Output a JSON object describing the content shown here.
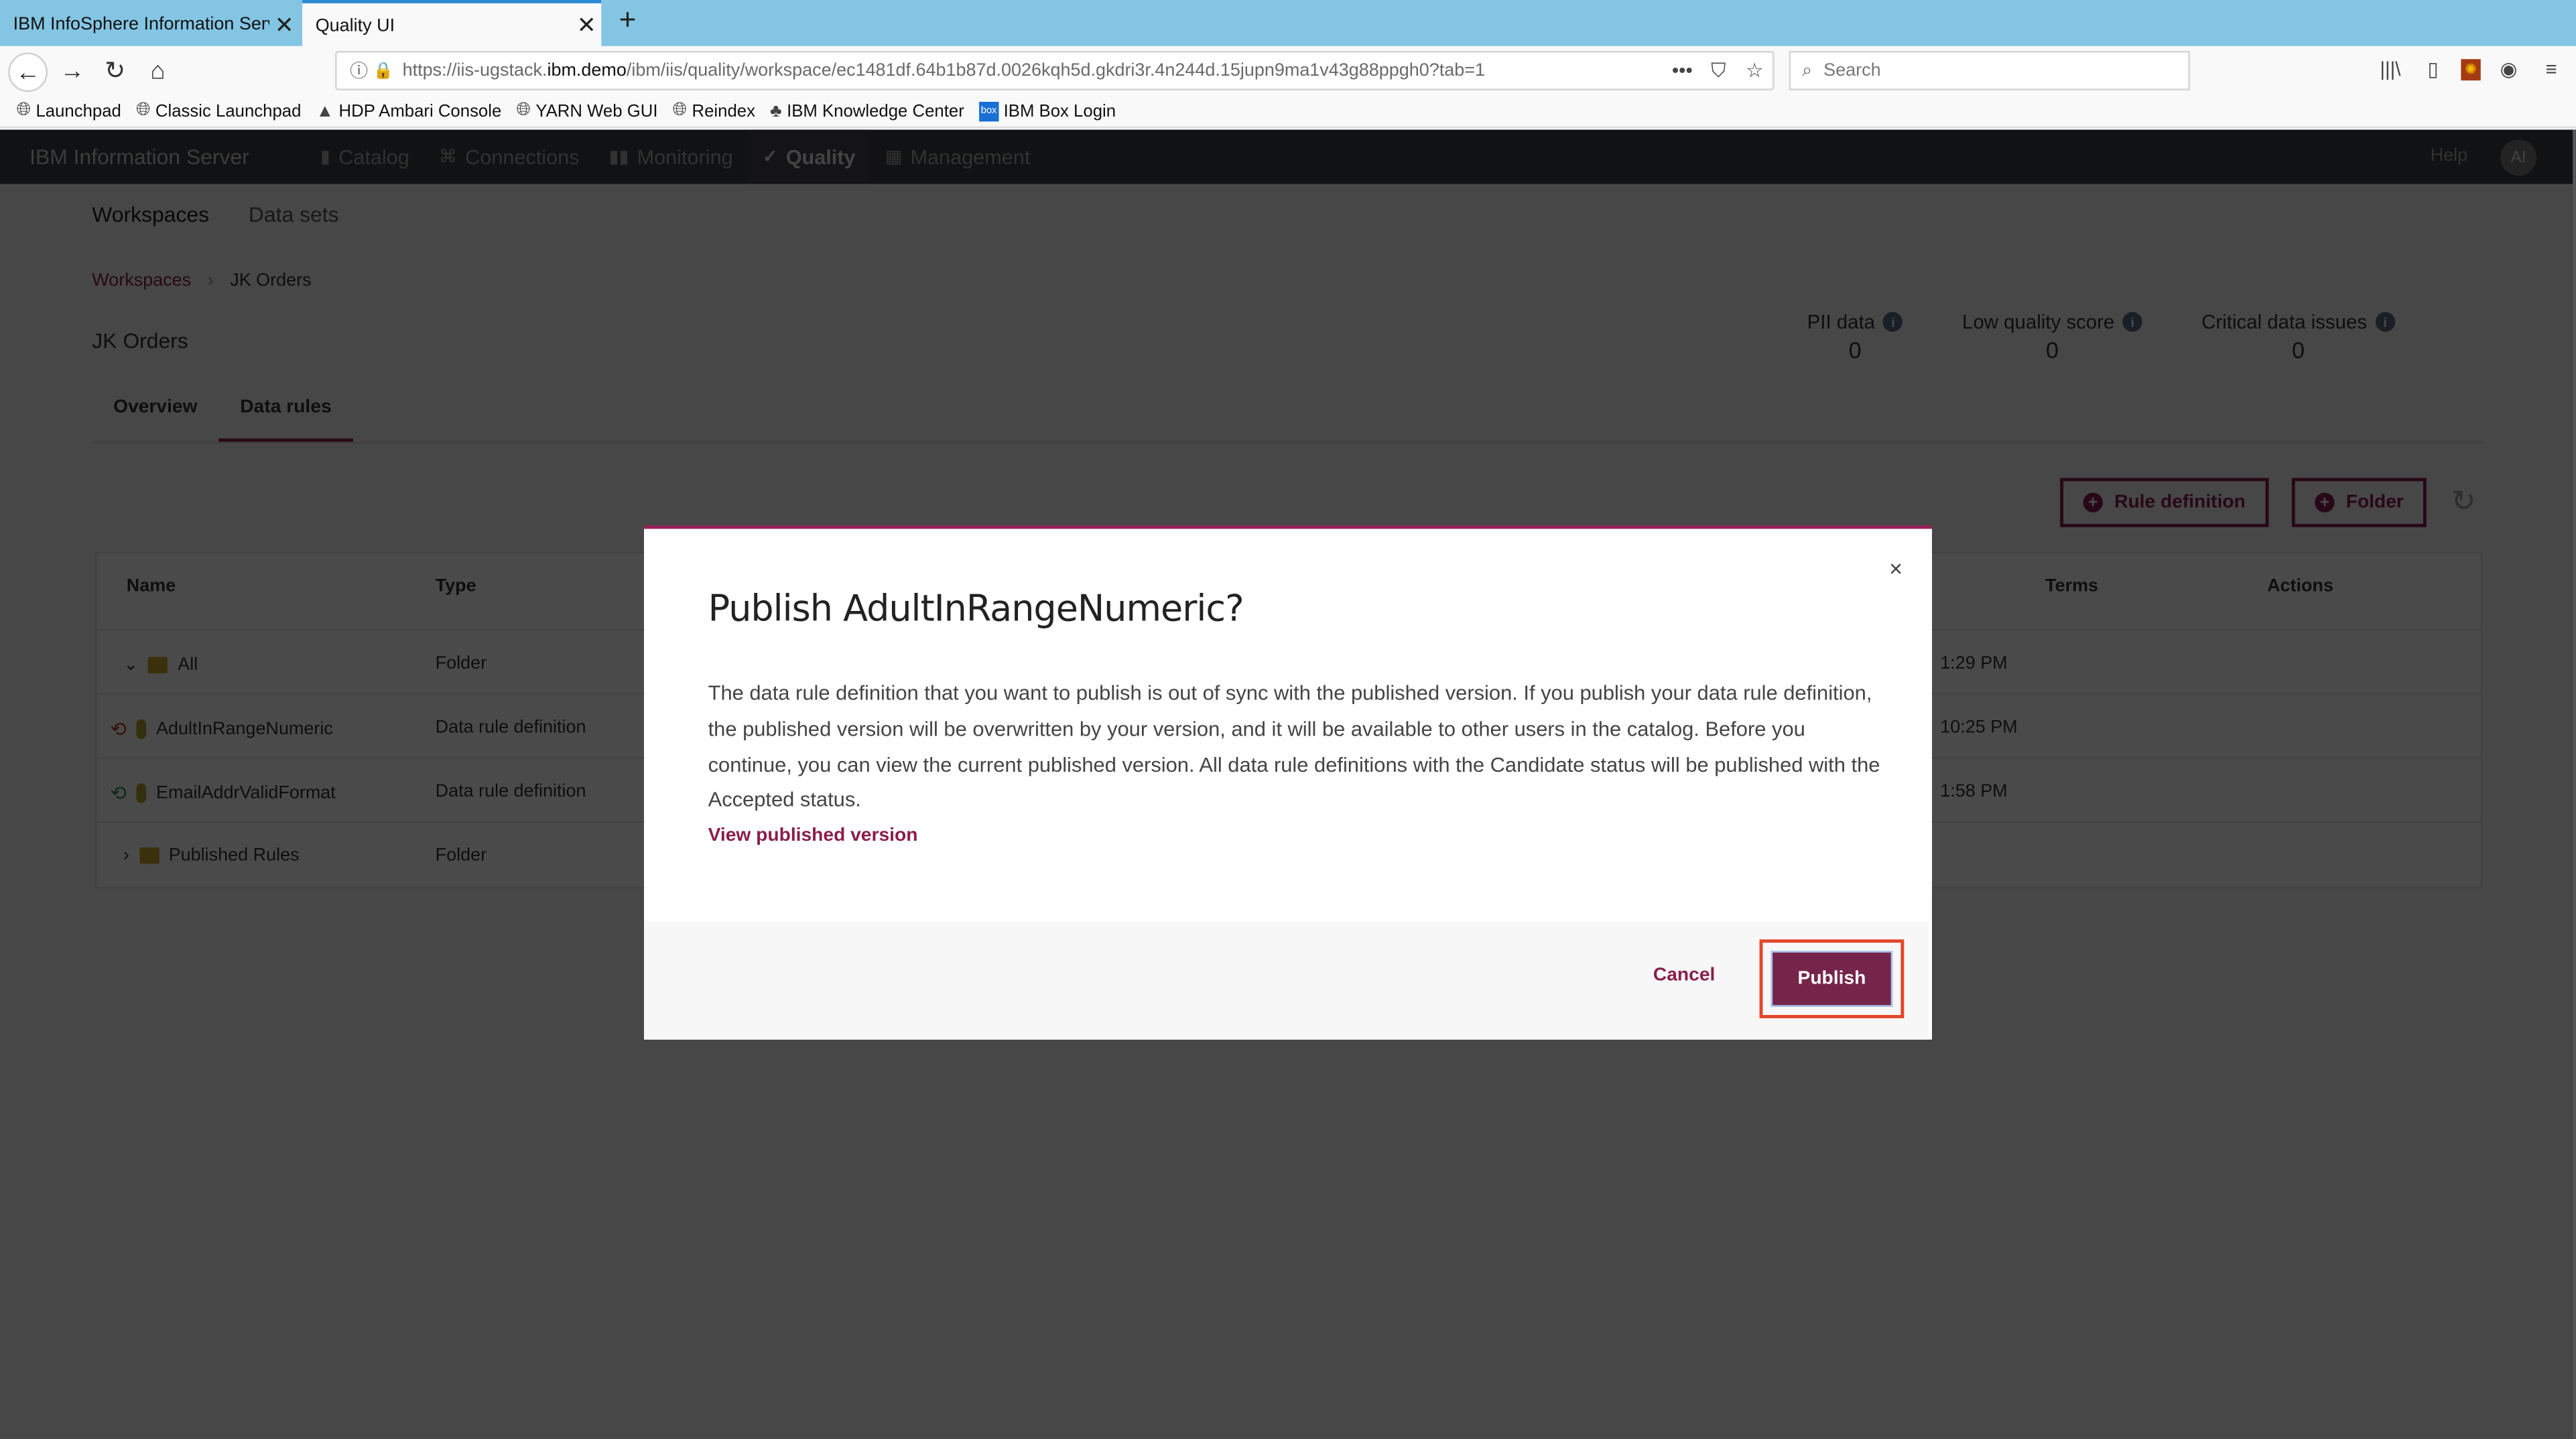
{
  "browser": {
    "tabs": [
      {
        "label": "IBM InfoSphere Information Server",
        "active": false
      },
      {
        "label": "Quality UI",
        "active": true
      }
    ],
    "new_tab_icon": "plus-icon",
    "url": {
      "prefix": "https://iis-ugstack.",
      "domain": "ibm.demo",
      "path": "/ibm/iis/quality/workspace/ec1481df.64b1b87d.0026kqh5d.gkdri3r.4n244d.15jupn9ma1v43g88ppgh0?tab=1"
    },
    "search_placeholder": "Search",
    "bookmarks": [
      {
        "label": "Launchpad",
        "icon": "globe-icon"
      },
      {
        "label": "Classic Launchpad",
        "icon": "globe-icon"
      },
      {
        "label": "HDP Ambari Console",
        "icon": "ambari-icon"
      },
      {
        "label": "YARN Web GUI",
        "icon": "globe-icon"
      },
      {
        "label": "Reindex",
        "icon": "globe-icon"
      },
      {
        "label": "IBM Knowledge Center",
        "icon": "knowledge-center-icon"
      },
      {
        "label": "IBM Box Login",
        "icon": "box-icon"
      }
    ]
  },
  "app": {
    "brand": "IBM Information Server",
    "nav": [
      {
        "label": "Catalog",
        "icon": "catalog-icon"
      },
      {
        "label": "Connections",
        "icon": "connections-icon"
      },
      {
        "label": "Monitoring",
        "icon": "monitoring-icon"
      },
      {
        "label": "Quality",
        "icon": "check-circle-icon",
        "active": true
      },
      {
        "label": "Management",
        "icon": "calendar-icon"
      }
    ],
    "help": "Help",
    "avatar_initials": "AI",
    "subnav": [
      "Workspaces",
      "Data sets"
    ],
    "breadcrumb": [
      "Workspaces",
      "JK Orders"
    ],
    "workspace_title": "JK Orders",
    "metrics": [
      {
        "label": "PII data",
        "value": "0"
      },
      {
        "label": "Low quality score",
        "value": "0"
      },
      {
        "label": "Critical data issues",
        "value": "0"
      }
    ],
    "tabs": [
      "Overview",
      "Data rules"
    ],
    "active_tab": "Data rules",
    "buttons": {
      "rule_definition": "Rule definition",
      "folder": "Folder"
    },
    "table": {
      "headers": {
        "name": "Name",
        "type": "Type",
        "terms": "Terms",
        "actions": "Actions"
      },
      "rows": [
        {
          "name": "All",
          "type": "Folder",
          "modified": "1:29 PM",
          "kind": "folder",
          "expander": "chevron-down"
        },
        {
          "name": "AdultInRangeNumeric",
          "type": "Data rule definition",
          "modified": "10:25 PM",
          "kind": "rule",
          "sync": "out-of-sync",
          "sync_color": "#c0392b"
        },
        {
          "name": "EmailAddrValidFormat",
          "type": "Data rule definition",
          "modified": "1:58 PM",
          "kind": "rule",
          "sync": "in-sync",
          "sync_color": "#2e8b57"
        },
        {
          "name": "Published Rules",
          "type": "Folder",
          "modified": "",
          "kind": "folder",
          "expander": "chevron-right"
        }
      ]
    }
  },
  "modal": {
    "title": "Publish AdultInRangeNumeric?",
    "body": "The data rule definition that you want to publish is out of sync with the published version. If you publish your data rule definition, the published version will be overwritten by your version, and it will be available to other users in the catalog. Before you continue, you can view the current published version. All data rule definitions with the Candidate status will be published with the Accepted status.",
    "link": "View published version",
    "cancel": "Cancel",
    "publish": "Publish",
    "close_glyph": "×"
  },
  "colors": {
    "accent": "#8a1e4d",
    "publish_button": "#76254a",
    "highlight_box": "#e2472a",
    "tabbar": "#84c5e3"
  }
}
